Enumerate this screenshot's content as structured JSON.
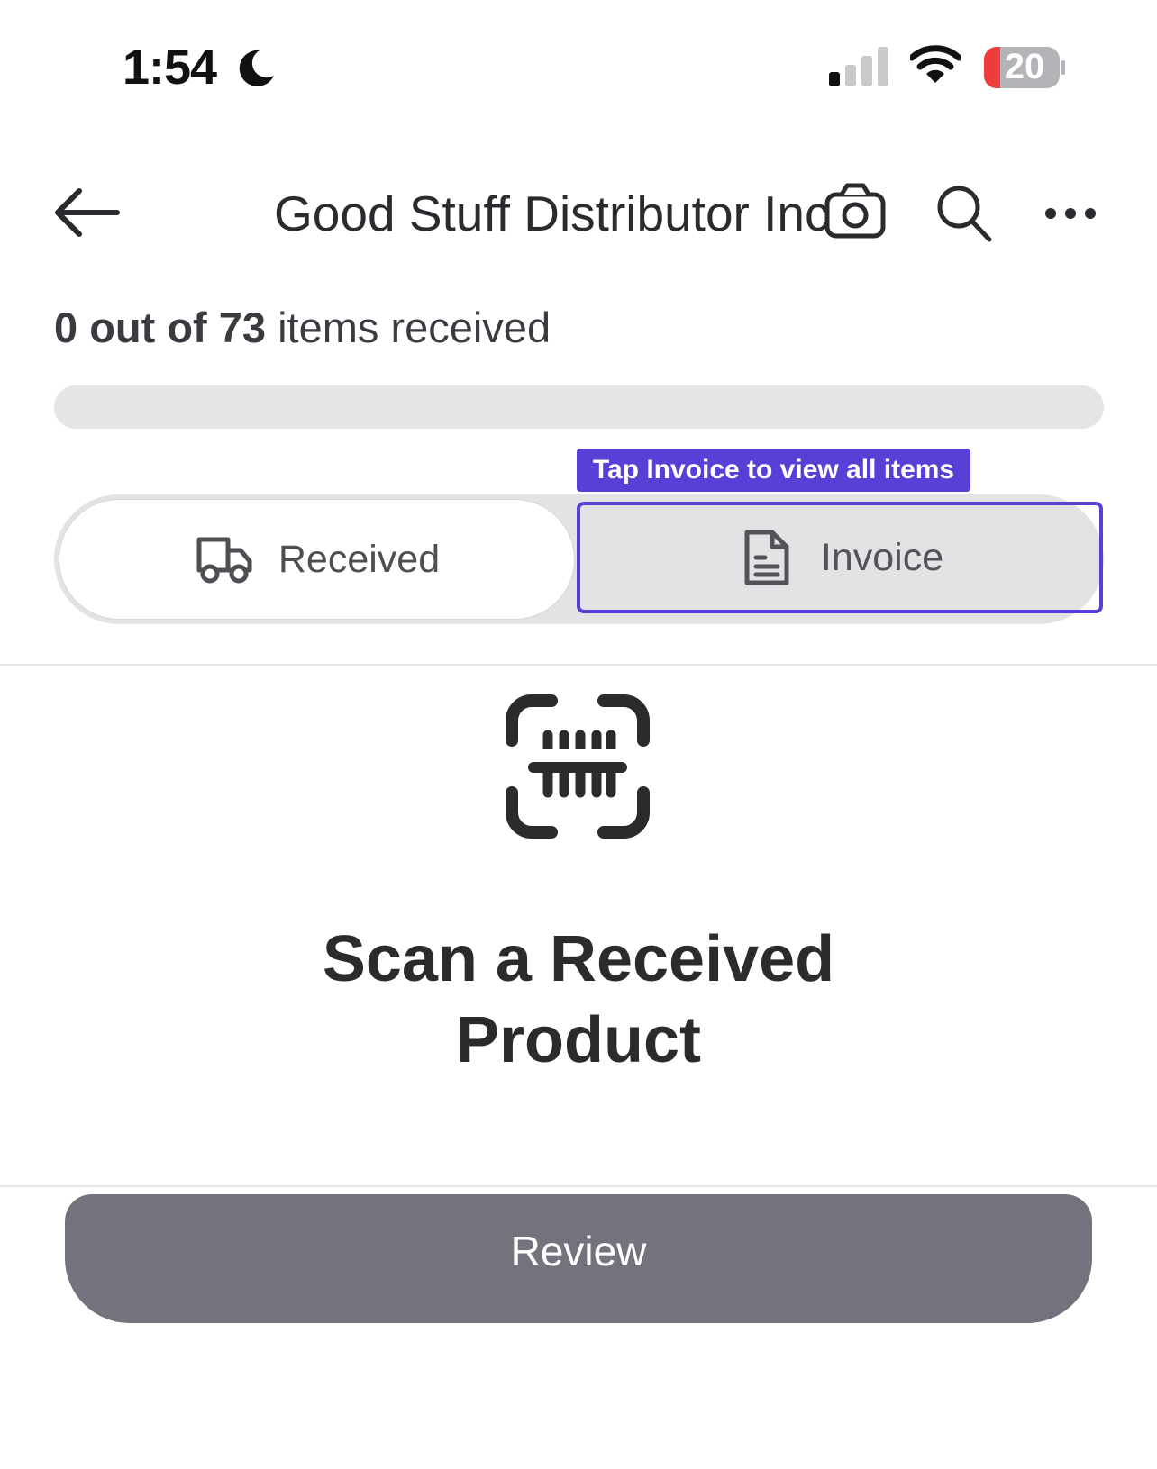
{
  "status_bar": {
    "time": "1:54",
    "battery": "20",
    "icons": [
      "moon-icon",
      "cellular-signal-icon",
      "wifi-icon",
      "battery-icon"
    ]
  },
  "header": {
    "title": "Good Stuff Distributor Inc.",
    "icons": [
      "back-arrow-icon",
      "camera-icon",
      "search-icon",
      "more-icon"
    ]
  },
  "progress": {
    "received": "0 out of 73",
    "suffix": " items received",
    "fraction": 0
  },
  "tooltip": "Tap Invoice to view all items",
  "tabs": [
    {
      "label": "Received",
      "icon": "truck-icon",
      "selected": true
    },
    {
      "label": "Invoice",
      "icon": "document-icon",
      "selected": false
    }
  ],
  "scan": {
    "icon": "barcode-scan-icon",
    "title": "Scan a Received Product"
  },
  "review_button": "Review",
  "colors": {
    "accent": "#5a3fd7",
    "review_button": "#73737e",
    "track": "#e5e5e8"
  }
}
